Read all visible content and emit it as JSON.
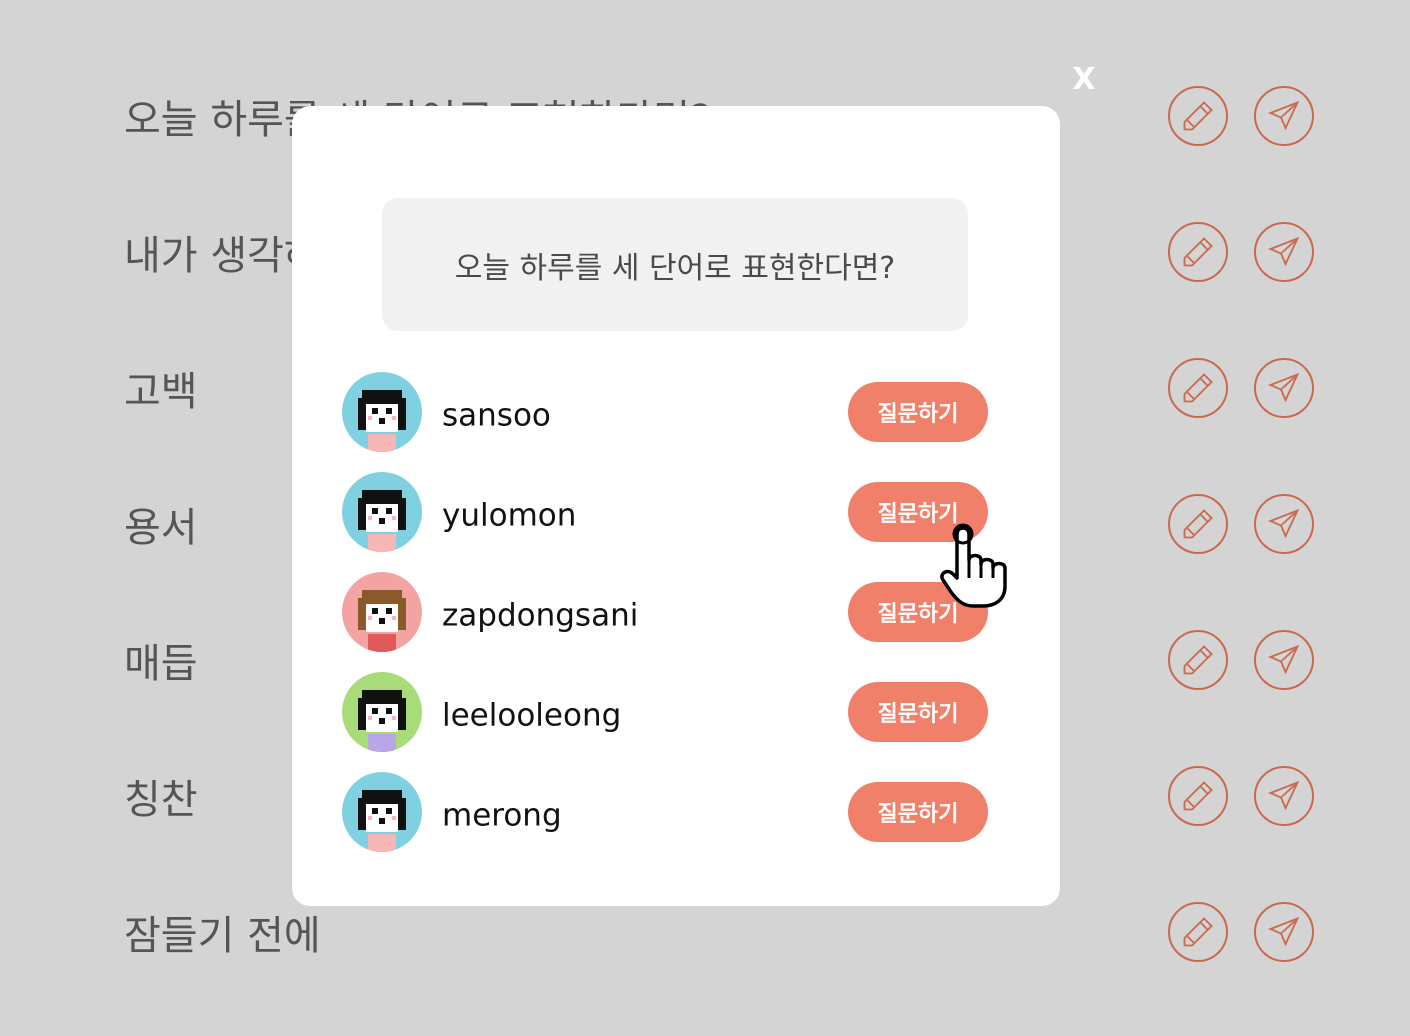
{
  "background": {
    "rows": [
      {
        "title": "오늘 하루를 세 단어로 표현한다면?"
      },
      {
        "title": "내가 생각하는"
      },
      {
        "title": "고백"
      },
      {
        "title": "용서"
      },
      {
        "title": "매듭"
      },
      {
        "title": "칭찬"
      },
      {
        "title": "잠들기 전에"
      }
    ]
  },
  "modal": {
    "close_label": "X",
    "question": "오늘 하루를 세 단어로 표현한다면?",
    "users": [
      {
        "name": "sansoo",
        "avatar_bg": "#7fd0e0",
        "shirt": "#f7b7b7",
        "hair": "#111111",
        "ask_label": "질문하기"
      },
      {
        "name": "yulomon",
        "avatar_bg": "#7fd0e0",
        "shirt": "#f7b7b7",
        "hair": "#111111",
        "ask_label": "질문하기"
      },
      {
        "name": "zapdongsani",
        "avatar_bg": "#f4a3a3",
        "shirt": "#e05a5a",
        "hair": "#8b5a2b",
        "ask_label": "질문하기"
      },
      {
        "name": "leelooleong",
        "avatar_bg": "#a8dc78",
        "shirt": "#b9a6e6",
        "hair": "#111111",
        "ask_label": "질문하기"
      },
      {
        "name": "merong",
        "avatar_bg": "#7fd0e0",
        "shirt": "#f7b7b7",
        "hair": "#111111",
        "ask_label": "질문하기"
      }
    ]
  },
  "colors": {
    "accent": "#f0806a",
    "icon_stroke": "#c9694f",
    "overlay": "#d4d4d4"
  },
  "icons": {
    "edit": "pencil-icon",
    "send": "paper-plane-icon",
    "cursor": "hand-pointer-icon"
  }
}
